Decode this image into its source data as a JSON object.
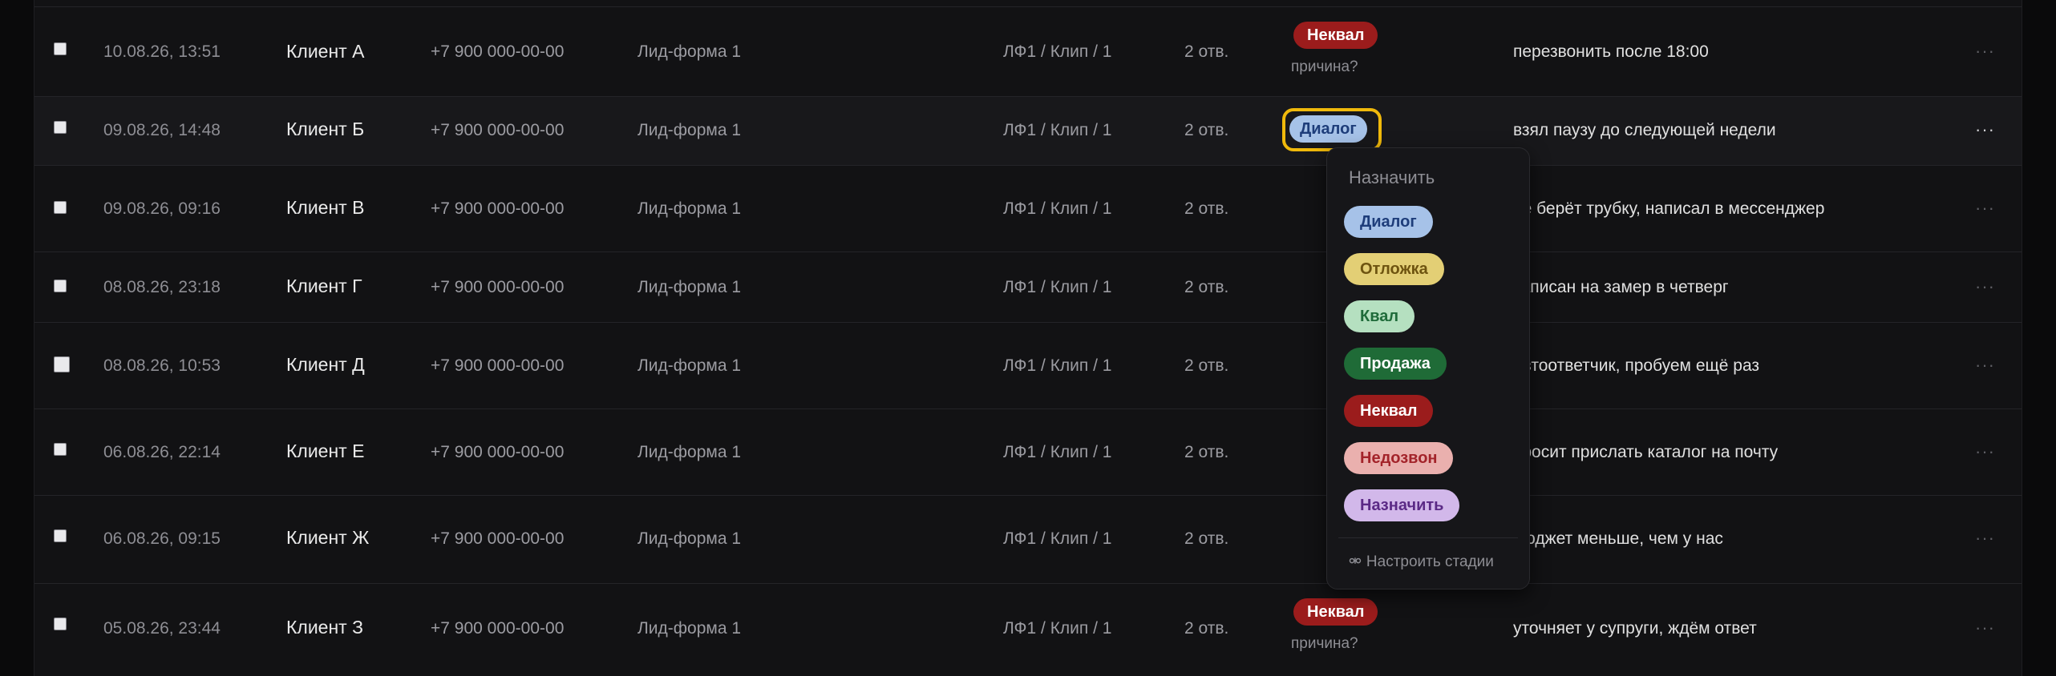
{
  "rows": [
    {
      "date": "10.08.26, 13:51",
      "name": "Клиент А",
      "phone": "+7 900 000-00-00",
      "form": "Лид-форма 1",
      "source": "ЛФ1 / Клип / 1",
      "answers": "2 отв.",
      "status": "Неквал",
      "reason": "причина?",
      "note": "перезвонить после 18:00",
      "more": "···"
    },
    {
      "date": "09.08.26, 14:48",
      "name": "Клиент Б",
      "phone": "+7 900 000-00-00",
      "form": "Лид-форма 1",
      "source": "ЛФ1 / Клип / 1",
      "answers": "2 отв.",
      "status": "Диалог",
      "note": "взял паузу до следующей недели",
      "more": "···"
    },
    {
      "date": "09.08.26, 09:16",
      "name": "Клиент В",
      "phone": "+7 900 000-00-00",
      "form": "Лид-форма 1",
      "source": "ЛФ1 / Клип / 1",
      "answers": "2 отв.",
      "note": "не берёт трубку, написал в мессенджер",
      "more": "···"
    },
    {
      "date": "08.08.26, 23:18",
      "name": "Клиент Г",
      "phone": "+7 900 000-00-00",
      "form": "Лид-форма 1",
      "source": "ЛФ1 / Клип / 1",
      "answers": "2 отв.",
      "note": "записан на замер в четверг",
      "more": "···"
    },
    {
      "date": "08.08.26, 10:53",
      "name": "Клиент Д",
      "phone": "+7 900 000-00-00",
      "form": "Лид-форма 1",
      "source": "ЛФ1 / Клип / 1",
      "answers": "2 отв.",
      "note": "автоответчик, пробуем ещё раз",
      "more": "···"
    },
    {
      "date": "06.08.26, 22:14",
      "name": "Клиент Е",
      "phone": "+7 900 000-00-00",
      "form": "Лид-форма 1",
      "source": "ЛФ1 / Клип / 1",
      "answers": "2 отв.",
      "note": "просит прислать каталог на почту",
      "more": "···"
    },
    {
      "date": "06.08.26, 09:15",
      "name": "Клиент Ж",
      "phone": "+7 900 000-00-00",
      "form": "Лид-форма 1",
      "source": "ЛФ1 / Клип / 1",
      "answers": "2 отв.",
      "note": "бюджет меньше, чем у нас",
      "more": "···"
    },
    {
      "date": "05.08.26, 23:44",
      "name": "Клиент З",
      "phone": "+7 900 000-00-00",
      "form": "Лид-форма 1",
      "source": "ЛФ1 / Клип / 1",
      "answers": "2 отв.",
      "status": "Неквал",
      "reason": "причина?",
      "note": "уточняет у супруги, ждём ответ",
      "more": "···"
    }
  ],
  "stage_dropdown": {
    "title": "Назначить",
    "options": [
      {
        "label": "Диалог",
        "bg": "#a6c2e8",
        "fg": "#1e3d7a"
      },
      {
        "label": "Отложка",
        "bg": "#e3cf75",
        "fg": "#6e5410"
      },
      {
        "label": "Квал",
        "bg": "#b5e0c0",
        "fg": "#1f6b3a"
      },
      {
        "label": "Продажа",
        "bg": "#1f6b37",
        "fg": "#ffffff"
      },
      {
        "label": "Неквал",
        "bg": "#9b1c1c",
        "fg": "#ffffff"
      },
      {
        "label": "Недозвон",
        "bg": "#eab0ae",
        "fg": "#a3232a"
      },
      {
        "label": "Назначить",
        "bg": "#d2b8ea",
        "fg": "#5b2a86"
      }
    ],
    "footer": "Настроить стадии"
  },
  "colors": {
    "selection_outline": "#f0b90b",
    "neqval_badge": "#9b1c1c"
  }
}
